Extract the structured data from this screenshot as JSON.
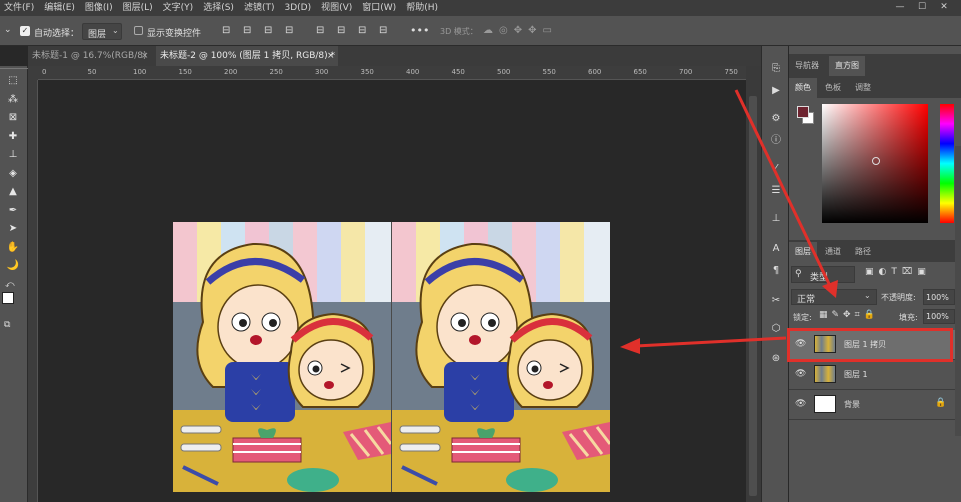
{
  "menubar": {
    "items": [
      "文件(F)",
      "编辑(E)",
      "图像(I)",
      "图层(L)",
      "文字(Y)",
      "选择(S)",
      "滤镜(T)",
      "3D(D)",
      "视图(V)",
      "窗口(W)",
      "帮助(H)"
    ],
    "window_controls": [
      "—",
      "☐",
      "✕"
    ]
  },
  "options": {
    "auto_select_label": "自动选择：",
    "auto_select_value": "图层",
    "show_transform_label": "显示变换控件",
    "mode_3d_label": "3D 模式："
  },
  "doc_tabs": [
    {
      "title": "未标题-1 @ 16.7%(RGB/8)",
      "close": "×"
    },
    {
      "title": "未标题-2 @ 100% (图层 1 拷贝, RGB/8) *",
      "close": "×"
    }
  ],
  "ruler": {
    "ticks": [
      "0",
      "50",
      "100",
      "150",
      "200",
      "250",
      "300",
      "350",
      "400",
      "450",
      "500",
      "550",
      "600",
      "650",
      "700",
      "750"
    ]
  },
  "tools": [
    {
      "name": "marquee-icon",
      "glyph": "⬚"
    },
    {
      "name": "magic-wand-icon",
      "glyph": "⁂"
    },
    {
      "name": "frame-icon",
      "glyph": "⊠"
    },
    {
      "name": "healing-brush-icon",
      "glyph": "✚"
    },
    {
      "name": "clone-stamp-icon",
      "glyph": "⊥"
    },
    {
      "name": "eraser-icon",
      "glyph": "◈"
    },
    {
      "name": "blur-icon",
      "glyph": "▲"
    },
    {
      "name": "pen-icon",
      "glyph": "✒"
    },
    {
      "name": "path-select-icon",
      "glyph": "➤"
    },
    {
      "name": "hand-icon",
      "glyph": "✋"
    },
    {
      "name": "zoom-icon",
      "glyph": "🌙"
    }
  ],
  "navigator_tabs": [
    "导航器",
    "直方图"
  ],
  "color_tabs": [
    "颜色",
    "色板",
    "调整"
  ],
  "colors": {
    "foreground": "#6e2430",
    "background": "#ffffff",
    "picker_hue": "#ff0000",
    "highlight": "#e0302a"
  },
  "layers_panel": {
    "tabs": [
      "图层",
      "通道",
      "路径"
    ],
    "filter_label": "类型",
    "blend_mode": "正常",
    "opacity_label": "不透明度:",
    "opacity_value": "100%",
    "lock_label": "锁定:",
    "fill_label": "填充:",
    "fill_value": "100%",
    "layers": [
      {
        "name": "图层 1 拷贝",
        "selected": true,
        "visible": true
      },
      {
        "name": "图层 1",
        "selected": false,
        "visible": true
      },
      {
        "name": "背景",
        "selected": false,
        "visible": true,
        "locked": true
      }
    ]
  }
}
